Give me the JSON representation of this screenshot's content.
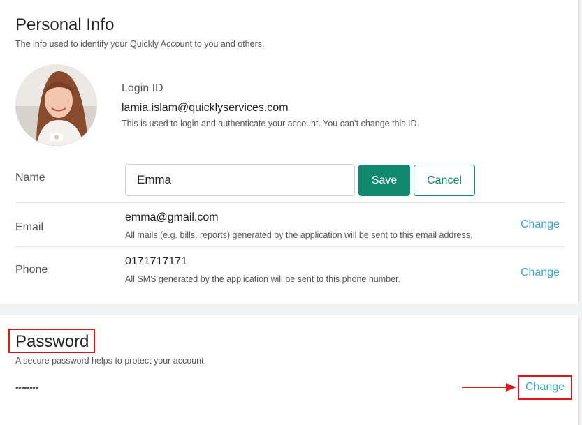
{
  "personal_info": {
    "title": "Personal Info",
    "subtitle": "The info used to identify your Quickly Account to you and others.",
    "avatar_icon": "camera-icon",
    "login": {
      "label": "Login ID",
      "value": "lamia.islam@quicklyservices.com",
      "help": "This is used to login and authenticate your account. You can’t change this ID."
    },
    "name": {
      "label": "Name",
      "value": "Emma",
      "save_label": "Save",
      "cancel_label": "Cancel"
    },
    "email": {
      "label": "Email",
      "value": "emma@gmail.com",
      "help": "All mails (e.g. bills, reports) generated by the application will be sent to this email address.",
      "change_label": "Change"
    },
    "phone": {
      "label": "Phone",
      "value": "0171717171",
      "help": "All SMS generated by the application will be sent to this phone number.",
      "change_label": "Change"
    }
  },
  "password": {
    "title": "Password",
    "subtitle": "A secure password helps to protect your account.",
    "masked_value": "••••••••",
    "change_label": "Change"
  },
  "colors": {
    "primary": "#0f8a6f",
    "link": "#3aa7d4",
    "highlight": "#e0161c"
  }
}
